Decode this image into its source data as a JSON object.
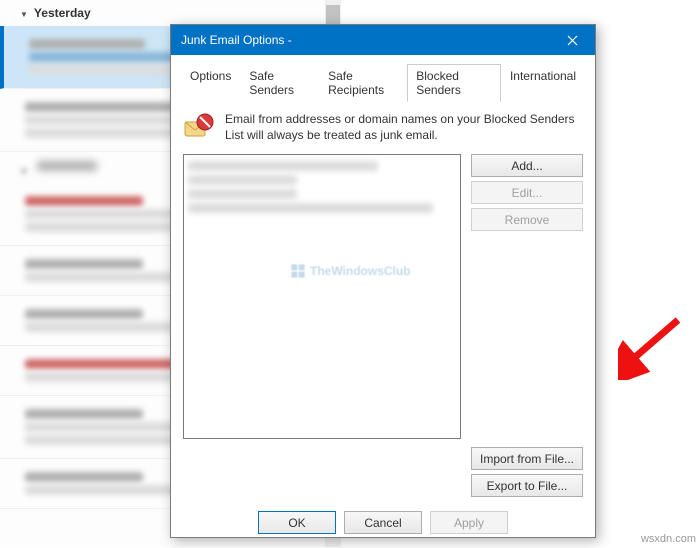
{
  "background": {
    "group_label": "Yesterday"
  },
  "dialog": {
    "title": "Junk Email Options - ",
    "tabs": {
      "options": "Options",
      "safe_senders": "Safe Senders",
      "safe_recipients": "Safe Recipients",
      "blocked_senders": "Blocked Senders",
      "international": "International"
    },
    "description": "Email from addresses or domain names on your Blocked Senders List will always be treated as junk email.",
    "buttons": {
      "add": "Add...",
      "edit": "Edit...",
      "remove": "Remove",
      "import": "Import from File...",
      "export": "Export to File...",
      "ok": "OK",
      "cancel": "Cancel",
      "apply": "Apply"
    }
  },
  "watermark": "TheWindowsClub",
  "credit": "wsxdn.com"
}
